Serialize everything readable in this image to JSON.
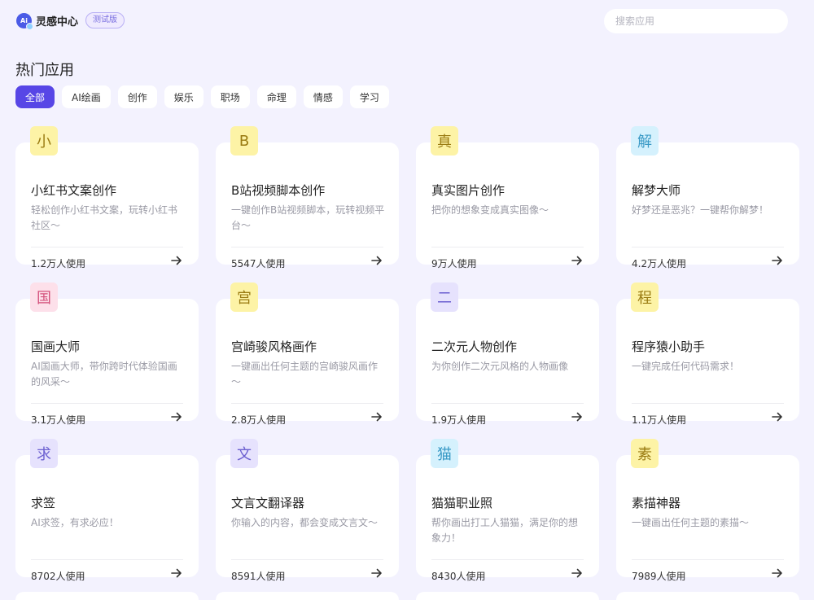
{
  "header": {
    "app_name": "灵感中心",
    "logo_text": "Ai",
    "badge": "测试版",
    "search_placeholder": "搜索应用"
  },
  "section_title": "热门应用",
  "tabs": [
    {
      "label": "全部",
      "active": true
    },
    {
      "label": "AI绘画",
      "active": false
    },
    {
      "label": "创作",
      "active": false
    },
    {
      "label": "娱乐",
      "active": false
    },
    {
      "label": "职场",
      "active": false
    },
    {
      "label": "命理",
      "active": false
    },
    {
      "label": "情感",
      "active": false
    },
    {
      "label": "学习",
      "active": false
    }
  ],
  "apps": [
    {
      "icon": "小",
      "icon_bg": "#fdf3a6",
      "icon_color": "#9a7b12",
      "title": "小红书文案创作",
      "desc": "轻松创作小红书文案，玩转小红书社区～",
      "usage": "1.2万人使用"
    },
    {
      "icon": "B",
      "icon_bg": "#fdf3a6",
      "icon_color": "#9a7b12",
      "title": "B站视频脚本创作",
      "desc": "一键创作B站视频脚本，玩转视频平台～",
      "usage": "5547人使用"
    },
    {
      "icon": "真",
      "icon_bg": "#fdf3a6",
      "icon_color": "#9a7b12",
      "title": "真实图片创作",
      "desc": "把你的想象变成真实图像～",
      "usage": "9万人使用"
    },
    {
      "icon": "解",
      "icon_bg": "#d5f1fd",
      "icon_color": "#3a9ac6",
      "title": "解梦大师",
      "desc": "好梦还是恶兆？一键帮你解梦！",
      "usage": "4.2万人使用"
    },
    {
      "icon": "国",
      "icon_bg": "#fde0ea",
      "icon_color": "#d4517c",
      "title": "国画大师",
      "desc": "AI国画大师，带你跨时代体验国画的风采～",
      "usage": "3.1万人使用"
    },
    {
      "icon": "宫",
      "icon_bg": "#fdf3a6",
      "icon_color": "#9a7b12",
      "title": "宫崎骏风格画作",
      "desc": "一键画出任何主题的宫崎骏风画作～",
      "usage": "2.8万人使用"
    },
    {
      "icon": "二",
      "icon_bg": "#e6e2fd",
      "icon_color": "#6b5ed0",
      "title": "二次元人物创作",
      "desc": "为你创作二次元风格的人物画像",
      "usage": "1.9万人使用"
    },
    {
      "icon": "程",
      "icon_bg": "#fdf3a6",
      "icon_color": "#9a7b12",
      "title": "程序猿小助手",
      "desc": "一键完成任何代码需求！",
      "usage": "1.1万人使用"
    },
    {
      "icon": "求",
      "icon_bg": "#e6e2fd",
      "icon_color": "#6b5ed0",
      "title": "求签",
      "desc": "AI求签，有求必应！",
      "usage": "8702人使用"
    },
    {
      "icon": "文",
      "icon_bg": "#e6e2fd",
      "icon_color": "#6b5ed0",
      "title": "文言文翻译器",
      "desc": "你输入的内容，都会变成文言文～",
      "usage": "8591人使用"
    },
    {
      "icon": "猫",
      "icon_bg": "#d5f1fd",
      "icon_color": "#3a9ac6",
      "title": "猫猫职业照",
      "desc": "帮你画出打工人猫猫，满足你的想象力！",
      "usage": "8430人使用"
    },
    {
      "icon": "素",
      "icon_bg": "#fdf3a6",
      "icon_color": "#9a7b12",
      "title": "素描神器",
      "desc": "一键画出任何主题的素描～",
      "usage": "7989人使用"
    }
  ]
}
